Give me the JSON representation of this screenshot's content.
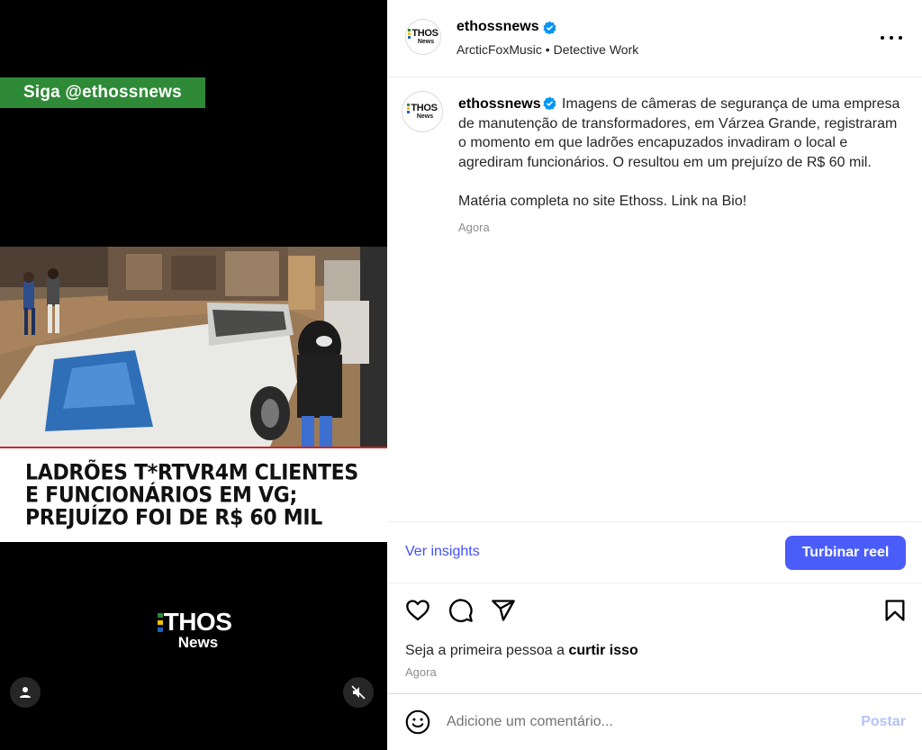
{
  "video": {
    "follow_banner": "Siga @ethossnews",
    "headline": [
      "LADRÕES T*RTVR4M CLIENTES",
      "E FUNCIONÁRIOS EM VG;",
      "PREJUÍZO FOI DE R$ 60 MIL"
    ],
    "logo_main": "THOS",
    "logo_sub": "News",
    "user_button_icon": "user-icon",
    "mute_button_icon": "muted-speaker-icon"
  },
  "header": {
    "username": "ethossnews",
    "audio": "ArcticFoxMusic",
    "separator": "•",
    "track": "Detective Work",
    "avatar_text": "THOS",
    "avatar_sub": "News"
  },
  "caption": {
    "username": "ethossnews",
    "text": "Imagens de câmeras de segurança de uma empresa de manutenção de transformadores, em Várzea Grande, registraram o momento em que ladrões encapuzados invadiram o local e agrediram funcionários. O resultou em um prejuízo de R$ 60 mil.\n\nMatéria completa no site Ethoss. Link na Bio!",
    "time": "Agora"
  },
  "insights": {
    "link": "Ver insights",
    "boost_button": "Turbinar reel"
  },
  "actions": {
    "likes_prefix": "Seja a primeira pessoa a",
    "likes_action": "curtir isso",
    "time": "Agora"
  },
  "comment": {
    "placeholder": "Adicione um comentário...",
    "post_button": "Postar"
  },
  "colors": {
    "accent": "#4a5df9",
    "link": "#4150f7",
    "verified": "#0095f6",
    "banner_green": "#2f8a37",
    "logo_green": "#2f8a37",
    "logo_yellow": "#f2c300",
    "logo_blue": "#1f5fbf"
  }
}
